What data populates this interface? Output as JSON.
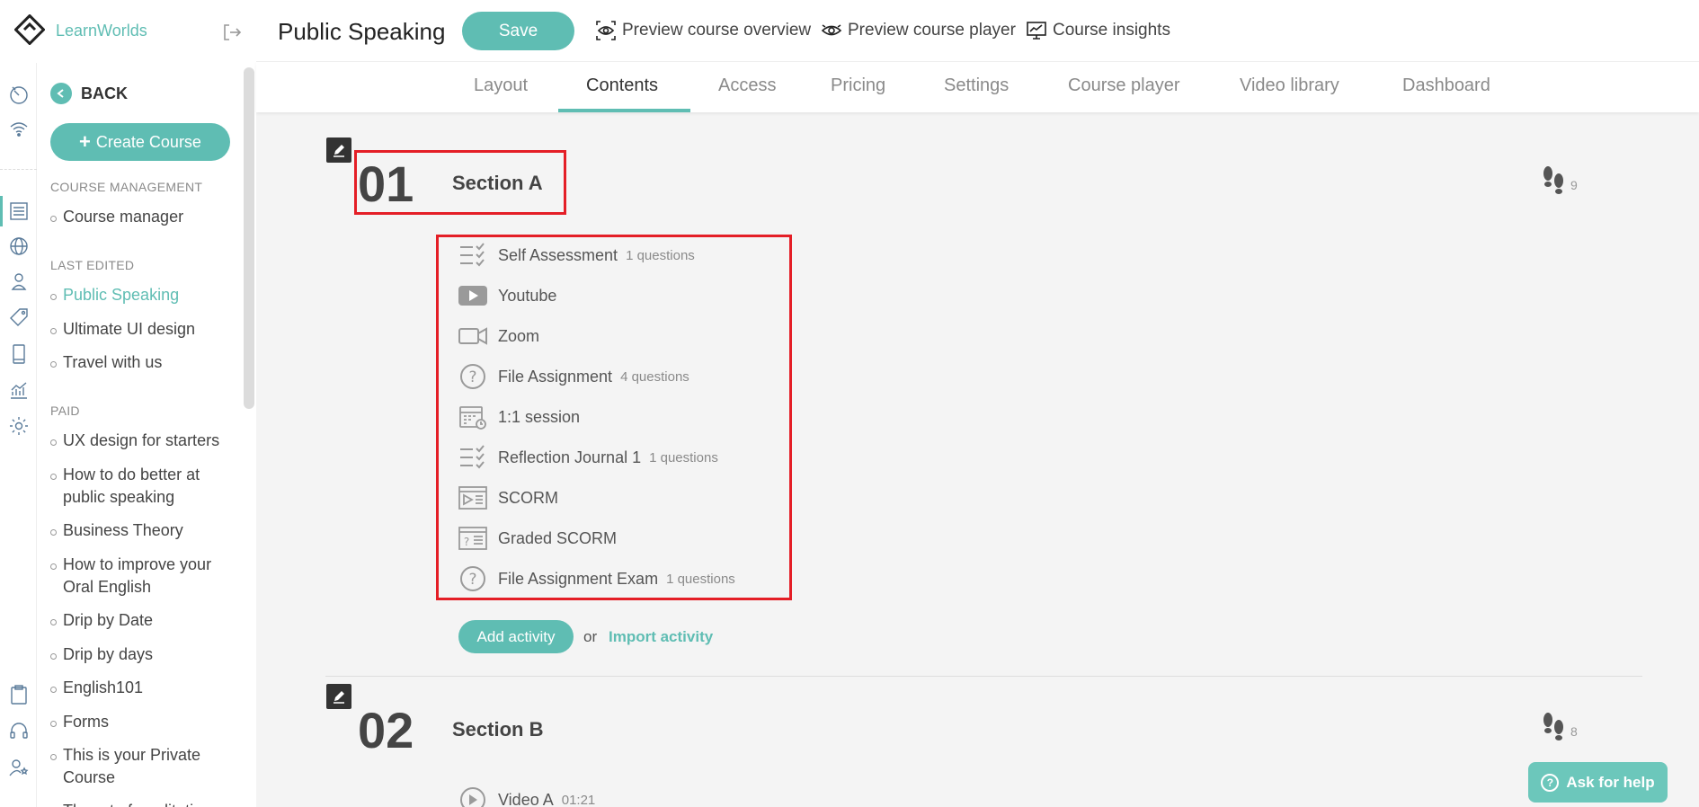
{
  "app": {
    "brand": "LearnWorlds",
    "accent_color": "#5fbdb3",
    "highlight_color": "#e41e26"
  },
  "rail_icons": [
    "dashboard-icon",
    "wifi-icon",
    "courses-icon",
    "globe-icon",
    "users-icon",
    "tag-icon",
    "mobile-icon",
    "analytics-icon",
    "settings-icon",
    "clipboard-icon",
    "headset-icon",
    "stars-user-icon"
  ],
  "sidebar": {
    "back_label": "BACK",
    "create_label": "Create Course",
    "sections": [
      {
        "heading": "COURSE MANAGEMENT",
        "items": [
          "Course manager"
        ]
      },
      {
        "heading": "LAST EDITED",
        "items": [
          "Public Speaking",
          "Ultimate UI design",
          "Travel with us"
        ]
      },
      {
        "heading": "PAID",
        "items": [
          "UX design for starters",
          "How to do better at public speaking",
          "Business Theory",
          "How to improve your Oral English",
          "Drip by Date",
          "Drip by days",
          "English101",
          "Forms",
          "This is your Private Course",
          "The art of meditation"
        ]
      }
    ]
  },
  "header": {
    "course_title": "Public Speaking",
    "save_label": "Save",
    "preview_overview": "Preview course overview",
    "preview_player": "Preview course player",
    "insights": "Course insights"
  },
  "tabs": [
    "Layout",
    "Contents",
    "Access",
    "Pricing",
    "Settings",
    "Course player",
    "Video library",
    "Dashboard"
  ],
  "active_tab": "Contents",
  "sections": [
    {
      "number": "01",
      "title": "Section A",
      "steps": "9",
      "activities": [
        {
          "icon": "checklist-icon",
          "name": "Self Assessment",
          "meta": "1 questions"
        },
        {
          "icon": "youtube-icon",
          "name": "Youtube",
          "meta": ""
        },
        {
          "icon": "zoom-icon",
          "name": "Zoom",
          "meta": ""
        },
        {
          "icon": "question-icon",
          "name": "File Assignment",
          "meta": "4 questions"
        },
        {
          "icon": "calendar-icon",
          "name": "1:1 session",
          "meta": ""
        },
        {
          "icon": "checklist-icon",
          "name": "Reflection Journal 1",
          "meta": "1 questions"
        },
        {
          "icon": "scorm-icon",
          "name": "SCORM",
          "meta": ""
        },
        {
          "icon": "graded-scorm-icon",
          "name": "Graded SCORM",
          "meta": ""
        },
        {
          "icon": "question-icon",
          "name": "File Assignment Exam",
          "meta": "1 questions"
        }
      ]
    },
    {
      "number": "02",
      "title": "Section B",
      "steps": "8",
      "activities": [
        {
          "icon": "video-icon",
          "name": "Video A",
          "meta": "01:21"
        }
      ]
    }
  ],
  "actions": {
    "add_activity": "Add activity",
    "or": "or",
    "import_activity": "Import activity"
  },
  "help": {
    "label": "Ask for help"
  }
}
